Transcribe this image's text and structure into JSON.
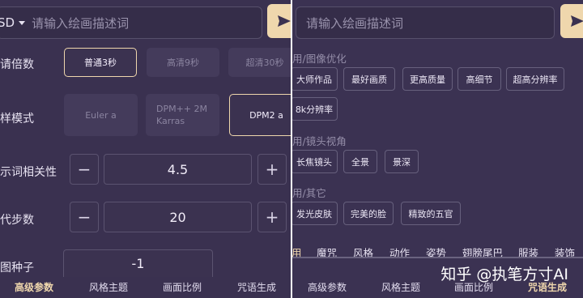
{
  "left": {
    "search": {
      "model": "SD",
      "placeholder": "请输入绘画描述词"
    },
    "rows": {
      "upscale_label": "请倍数",
      "sampler_label": "样模式",
      "cfg_label": "示词相关性",
      "steps_label": "代步数",
      "seed_label": "图种子"
    },
    "upscale_options": [
      "普通3秒",
      "高清9秒",
      "超清30秒"
    ],
    "sampler_options": [
      "Euler a",
      "DPM++ 2M Karras",
      "DPM2 a"
    ],
    "cfg": {
      "minus": "−",
      "value": "4.5",
      "plus": "+"
    },
    "steps": {
      "minus": "−",
      "value": "20",
      "plus": "+"
    },
    "seed": {
      "value": "-1"
    },
    "tabs": [
      "高级参数",
      "风格主题",
      "画面比例",
      "咒语生成"
    ]
  },
  "right": {
    "search": {
      "placeholder": "请输入绘画描述词"
    },
    "sections": [
      {
        "title": "用/图像优化",
        "tags": [
          "大师作品",
          "最好画质",
          "更高质量",
          "高细节",
          "超高分辨率",
          "8k分辨率"
        ]
      },
      {
        "title": "用/镜头视角",
        "tags": [
          "长焦镜头",
          "全景",
          "景深"
        ]
      },
      {
        "title": "用/其它",
        "tags": [
          "发光皮肤",
          "完美的脸",
          "精致的五官"
        ]
      }
    ],
    "categories": [
      "用",
      "魔咒",
      "风格",
      "动作",
      "姿势",
      "翅膀尾巴",
      "服装",
      "装饰"
    ],
    "tabs": [
      "高级参数",
      "风格主题",
      "画面比例",
      "咒语生成"
    ],
    "watermark": "知乎 @执笔方寸AI"
  }
}
